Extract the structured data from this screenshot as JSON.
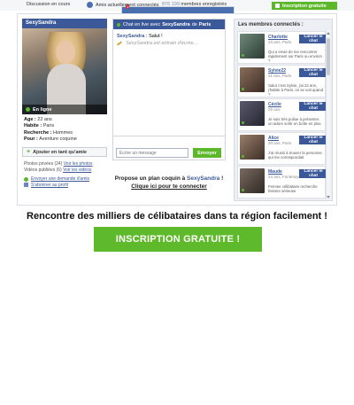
{
  "topbar": {
    "discussion_label": "Discussion en cours",
    "discussion_badge": "1",
    "friends_label": "Amis actuellement connectés",
    "members_count": "876 199",
    "members_label": "membres enregistrés",
    "signup_label": "Inscription gratuite"
  },
  "profile": {
    "username": "SexySandra",
    "status": "En ligne",
    "age_label": "Age :",
    "age": "22 ans",
    "habite_label": "Habite :",
    "habite": "Paris",
    "recherche_label": "Recherche :",
    "recherche": "Hommes",
    "pour_label": "Pour :",
    "pour": "Aventure coquine",
    "fav_button": "Ajouter en tant qu'amie",
    "photos_text": "Photos privées (24)",
    "photos_link": "Voir les photos",
    "videos_text": "Vidéos publiées (6)",
    "videos_link": "Voir les vidéos",
    "link_request": "Envoyer une demande d'amis",
    "link_subscribe": "S'abonner au profil"
  },
  "chat": {
    "head_prefix": "Chat en live avec",
    "head_name": "SexySandra",
    "head_mid": "de",
    "head_city": "Paris",
    "msg_name": "SexySandra",
    "msg_text": ": Salut !",
    "typing": "SexySandra est entrain d'écrire...",
    "input_placeholder": "Ecrire un message",
    "send_label": "Envoyer",
    "under_line1": "Propose un plan coquin à",
    "under_name": "SexySandra",
    "under_line1_end": "!",
    "under_line2": "Clique ici pour te connecter"
  },
  "members": {
    "title": "Les membres connectés :",
    "button_label": "Lancer le chat",
    "items": [
      {
        "name": "Charlotte",
        "info": "23 ans, Paris",
        "msg": "Qui a envie de me rencontrer rapidement sur Paris ou environ ?"
      },
      {
        "name": "Sylvie22",
        "info": "21 ans, Paris",
        "msg": "Salut c'est Sylvie, j'ai 22 ans, j'habite à Paris, on se voit quand ?"
      },
      {
        "name": "Cécile",
        "info": "25 ans",
        "msg": "Je suis très poilue à présenter, un adore sortir en boîte en plus"
      },
      {
        "name": "Alice",
        "info": "20 ans, Paris",
        "msg": "J'ai réussi à trouver la personne qui me correspondait"
      },
      {
        "name": "Maude",
        "info": "24 ans, Fontenay-s...",
        "msg": "Femme célibataire recherche histoire sérieuse"
      }
    ]
  },
  "page": {
    "tagline": "Rencontre des milliers de célibataires dans ta région facilement !",
    "cta_label": "INSCRIPTION GRATUITE !"
  },
  "colors": {
    "brand_blue": "#3b5998",
    "accent_green": "#5cb82a"
  }
}
